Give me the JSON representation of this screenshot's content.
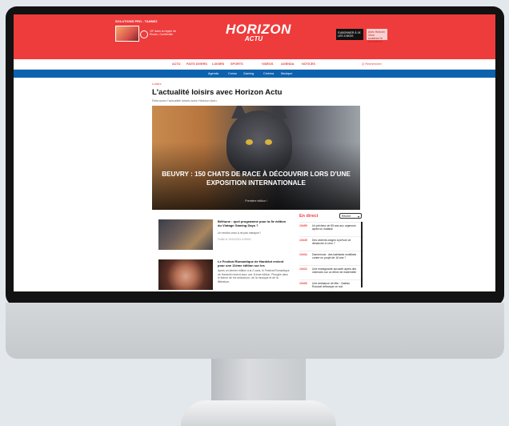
{
  "header": {
    "promo_label": "SOLUTIONS PRO - TANNEZ",
    "weather_text": "15° dans la région de Rouen, Gonfreville",
    "logo_line1": "HORIZON",
    "logo_line2": "ACTU",
    "subscribe_label": "S'ABONNER À 1€ LES 4 MOIS",
    "promo_box_label": "Avec Horizon Vous soutenez le journalisme"
  },
  "nav": {
    "items": [
      "ACTU",
      "FAITS DIVERS",
      "LOISIRS",
      "SPORTS",
      "VIDÉOS",
      "AGENDA",
      "NOTICES"
    ],
    "search_label": "Q Rechercher"
  },
  "subnav": {
    "items": [
      "Agenda",
      "Conso",
      "Gaming",
      "Cinéma",
      "Musique"
    ]
  },
  "page": {
    "breadcrumb": "Loisirs",
    "title": "L'actualité loisirs avec Horizon Actu",
    "subtitle": "Retrouvez l'actualité loisirs avec Horizon Actu."
  },
  "hero": {
    "title": "BEUVRY : 150 CHATS DE RACE À DÉCOUVRIR LORS D'UNE EXPOSITION INTERNATIONALE",
    "meta": "Première édition !"
  },
  "articles": [
    {
      "title": "Béthune : quel programme pour la 5e édition du Vintage Gaming Days ?",
      "body": "Un rendez-vous à ne pas manquer !",
      "meta": "Publié le 19/10/2023 à 09h00"
    },
    {
      "title": "Le Festival Romantique de Hardelot revient pour une 11ème édition sur les",
      "body": "Après un dernier édition à la 2 sans, le Festival Romantique de Hardelot revient avec une 11ème édition. Plongée dans le thème de «la séduction», de la musique et de la littérature."
    }
  ],
  "sidebar": {
    "title": "En direct",
    "select_label": "Récent",
    "items": [
      {
        "time": "13h59",
        "text": "Un pêcheur de 65 ans aux urgences après un malaise"
      },
      {
        "time": "13h45",
        "text": "Des violents orages à prévoir ce dimanche à Lens ?"
      },
      {
        "time": "13h34",
        "text": "Dannemois : des habitants mobilisés contre un projet de 16 ans ?"
      },
      {
        "time": "13h22",
        "text": "Une enseignante accusée après des violences sur un élève de maternelle"
      },
      {
        "time": "13h06",
        "text": "Une ambiance de fête : Gaétan Roussel débarque ce soir"
      }
    ]
  }
}
